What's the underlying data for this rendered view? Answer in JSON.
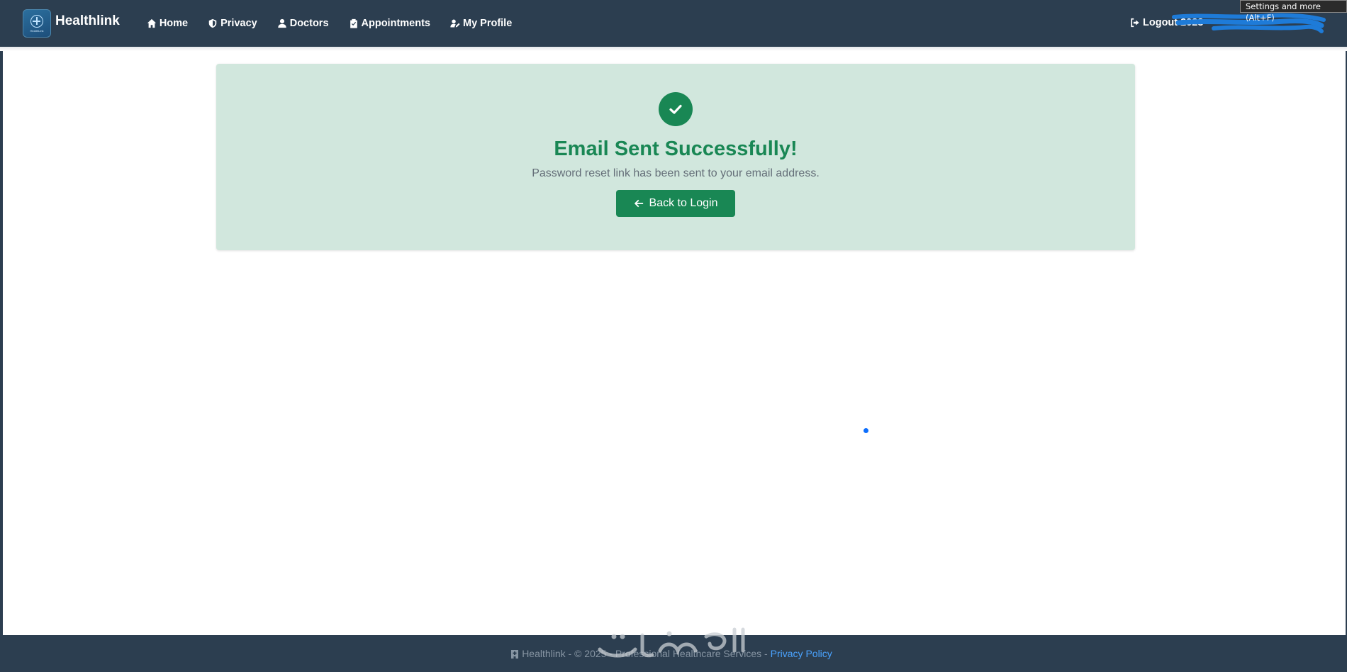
{
  "navbar": {
    "brand_name": "Healthlink",
    "brand_logo_text": "HealthLink",
    "links": [
      {
        "label": "Home",
        "icon": "home-icon"
      },
      {
        "label": "Privacy",
        "icon": "shield-icon"
      },
      {
        "label": "Doctors",
        "icon": "user-icon"
      },
      {
        "label": "Appointments",
        "icon": "clipboard-icon"
      },
      {
        "label": "My Profile",
        "icon": "user-edit-icon"
      }
    ],
    "logout_label": "Logout 2023",
    "logout_icon": "sign-out-icon"
  },
  "browser_tooltip": "Settings and more (Alt+F)",
  "card": {
    "icon": "check-circle-icon",
    "title": "Email Sent Successfully!",
    "message": "Password reset link has been sent to your email address.",
    "button_label": "Back to Login",
    "button_icon": "arrow-left-icon"
  },
  "footer": {
    "icon": "hospital-icon",
    "text": "Healthlink - © 2025 - Professional Healthcare Services - ",
    "privacy_link": "Privacy Policy"
  },
  "colors": {
    "nav_bg": "#2c3e50",
    "success": "#198754",
    "success_bg": "#d1e7dd",
    "link": "#4aa3ff"
  }
}
